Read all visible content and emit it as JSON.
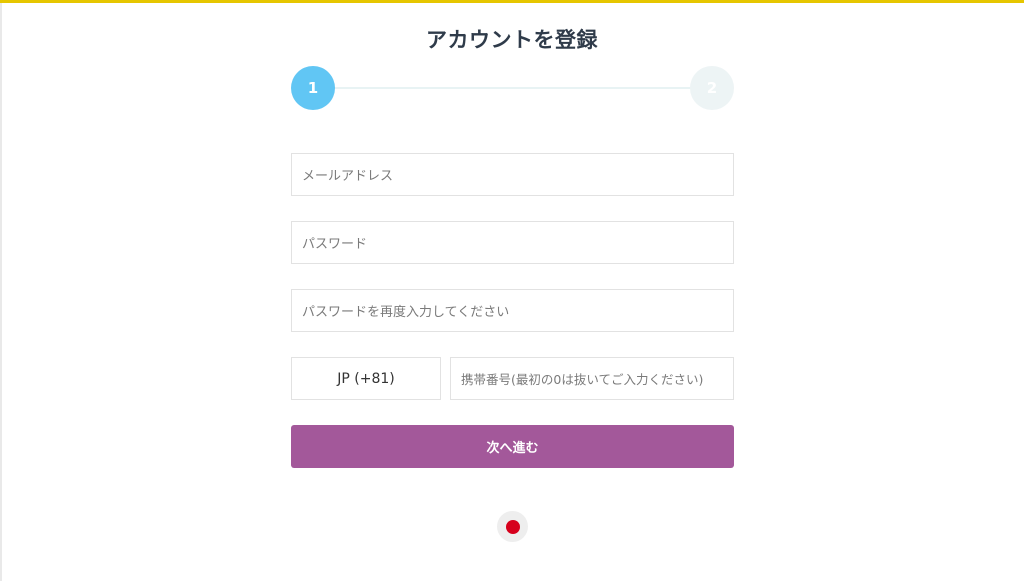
{
  "page": {
    "title": "アカウントを登録"
  },
  "stepper": {
    "steps": [
      {
        "label": "1",
        "state": "active"
      },
      {
        "label": "2",
        "state": "inactive"
      }
    ],
    "active_color": "#61c6f4",
    "inactive_color": "#edf4f5"
  },
  "form": {
    "email_placeholder": "メールアドレス",
    "password_placeholder": "パスワード",
    "password_confirm_placeholder": "パスワードを再度入力してください",
    "country_code": "JP (+81)",
    "phone_placeholder": "携帯番号(最初の0は抜いてご入力ください)",
    "next_button_label": "次へ進む",
    "button_color": "#a3589a"
  },
  "language": {
    "current_flag_icon": "japan-flag-icon"
  },
  "colors": {
    "top_bar": "#e6c600"
  }
}
